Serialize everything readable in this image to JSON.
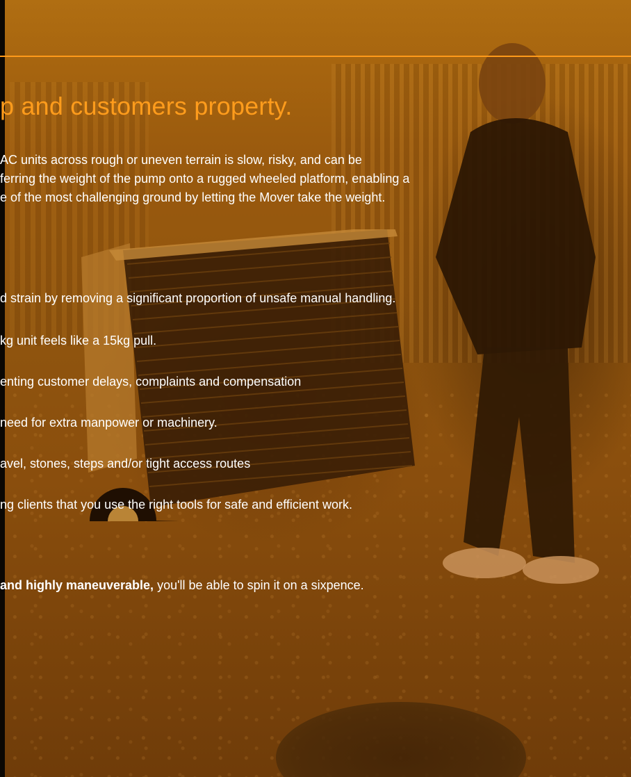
{
  "section": {
    "headline": "p and customers property.",
    "intro_lines": [
      "AC units across rough or uneven terrain is slow, risky, and can be",
      "ferring the weight of the pump onto a rugged wheeled platform, enabling a",
      "e of the most challenging ground by letting the Mover take the weight."
    ],
    "benefits": [
      "d strain by removing a significant proportion of unsafe manual handling.",
      "kg unit feels like a 15kg pull.",
      "enting customer delays, complaints and compensation",
      " need for extra manpower or machinery.",
      "avel, stones, steps and/or tight access routes",
      "ng clients that you use the right tools for safe and efficient work."
    ],
    "note_bold": "and highly maneuverable,",
    "note_rest": " you'll be able to spin it on a sixpence."
  },
  "colors": {
    "accent": "#ff9c1c",
    "divider": "#ff9a1a",
    "text": "#ffffff"
  }
}
